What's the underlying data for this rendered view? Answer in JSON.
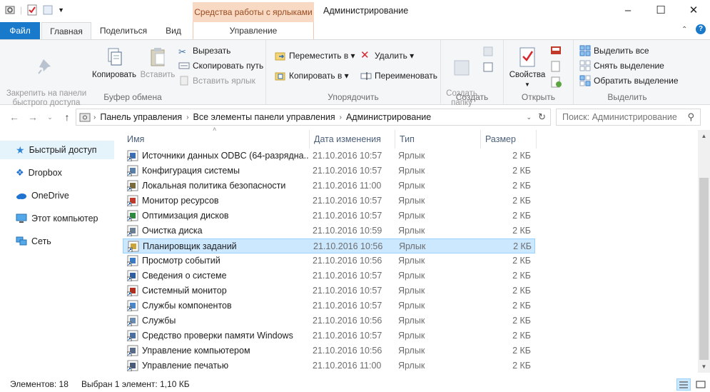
{
  "window": {
    "title": "Администрирование",
    "context_tab_group": "Средства работы с ярлыками"
  },
  "ribbon_tabs": [
    {
      "label": "Файл"
    },
    {
      "label": "Главная"
    },
    {
      "label": "Поделиться"
    },
    {
      "label": "Вид"
    },
    {
      "label": "Управление"
    }
  ],
  "ribbon": {
    "clipboard": {
      "group_label": "Буфер обмена",
      "pin": "Закрепить на панели\nбыстрого доступа",
      "copy": "Копировать",
      "paste": "Вставить",
      "cut": "Вырезать",
      "copy_path": "Скопировать путь",
      "paste_shortcut": "Вставить ярлык"
    },
    "organize": {
      "group_label": "Упорядочить",
      "move_to": "Переместить в ▾",
      "copy_to": "Копировать в ▾",
      "delete": "Удалить ▾",
      "rename": "Переименовать"
    },
    "new": {
      "group_label": "Создать",
      "new_folder": "Создать\nпапку"
    },
    "open": {
      "group_label": "Открыть",
      "properties": "Свойства"
    },
    "select": {
      "group_label": "Выделить",
      "select_all": "Выделить все",
      "select_none": "Снять выделение",
      "invert": "Обратить выделение"
    }
  },
  "address": {
    "crumbs": [
      "Панель управления",
      "Все элементы панели управления",
      "Администрирование"
    ],
    "search_placeholder": "Поиск: Администрирование"
  },
  "nav_pane": [
    {
      "label": "Быстрый доступ",
      "icon": "star-icon",
      "selected": true
    },
    {
      "label": "Dropbox",
      "icon": "dropbox-icon",
      "selected": false
    },
    {
      "label": "OneDrive",
      "icon": "onedrive-icon",
      "selected": false
    },
    {
      "label": "Этот компьютер",
      "icon": "computer-icon",
      "selected": false
    },
    {
      "label": "Сеть",
      "icon": "network-icon",
      "selected": false
    }
  ],
  "columns": {
    "name": "Имя",
    "date": "Дата изменения",
    "type": "Тип",
    "size": "Размер"
  },
  "files": [
    {
      "name": "Источники данных ODBC (64-разрядна...",
      "date": "21.10.2016 10:57",
      "type": "Ярлык",
      "size": "2 КБ"
    },
    {
      "name": "Конфигурация системы",
      "date": "21.10.2016 10:57",
      "type": "Ярлык",
      "size": "2 КБ"
    },
    {
      "name": "Локальная политика безопасности",
      "date": "21.10.2016 11:00",
      "type": "Ярлык",
      "size": "2 КБ"
    },
    {
      "name": "Монитор ресурсов",
      "date": "21.10.2016 10:57",
      "type": "Ярлык",
      "size": "2 КБ"
    },
    {
      "name": "Оптимизация дисков",
      "date": "21.10.2016 10:57",
      "type": "Ярлык",
      "size": "2 КБ"
    },
    {
      "name": "Очистка диска",
      "date": "21.10.2016 10:59",
      "type": "Ярлык",
      "size": "2 КБ"
    },
    {
      "name": "Планировщик заданий",
      "date": "21.10.2016 10:56",
      "type": "Ярлык",
      "size": "2 КБ",
      "selected": true
    },
    {
      "name": "Просмотр событий",
      "date": "21.10.2016 10:56",
      "type": "Ярлык",
      "size": "2 КБ"
    },
    {
      "name": "Сведения о системе",
      "date": "21.10.2016 10:57",
      "type": "Ярлык",
      "size": "2 КБ"
    },
    {
      "name": "Системный монитор",
      "date": "21.10.2016 10:57",
      "type": "Ярлык",
      "size": "2 КБ"
    },
    {
      "name": "Службы компонентов",
      "date": "21.10.2016 10:57",
      "type": "Ярлык",
      "size": "2 КБ"
    },
    {
      "name": "Службы",
      "date": "21.10.2016 10:56",
      "type": "Ярлык",
      "size": "2 КБ"
    },
    {
      "name": "Средство проверки памяти Windows",
      "date": "21.10.2016 10:57",
      "type": "Ярлык",
      "size": "2 КБ"
    },
    {
      "name": "Управление компьютером",
      "date": "21.10.2016 10:56",
      "type": "Ярлык",
      "size": "2 КБ"
    },
    {
      "name": "Управление печатью",
      "date": "21.10.2016 11:00",
      "type": "Ярлык",
      "size": "2 КБ"
    }
  ],
  "status": {
    "count": "Элементов: 18",
    "selection": "Выбран 1 элемент: 1,10 КБ"
  },
  "colors": {
    "file_tab": "#1979ca",
    "context_tab": "#f7d9c4",
    "selection_bg": "#cce8ff",
    "nav_selected_bg": "#e5f3fb"
  }
}
